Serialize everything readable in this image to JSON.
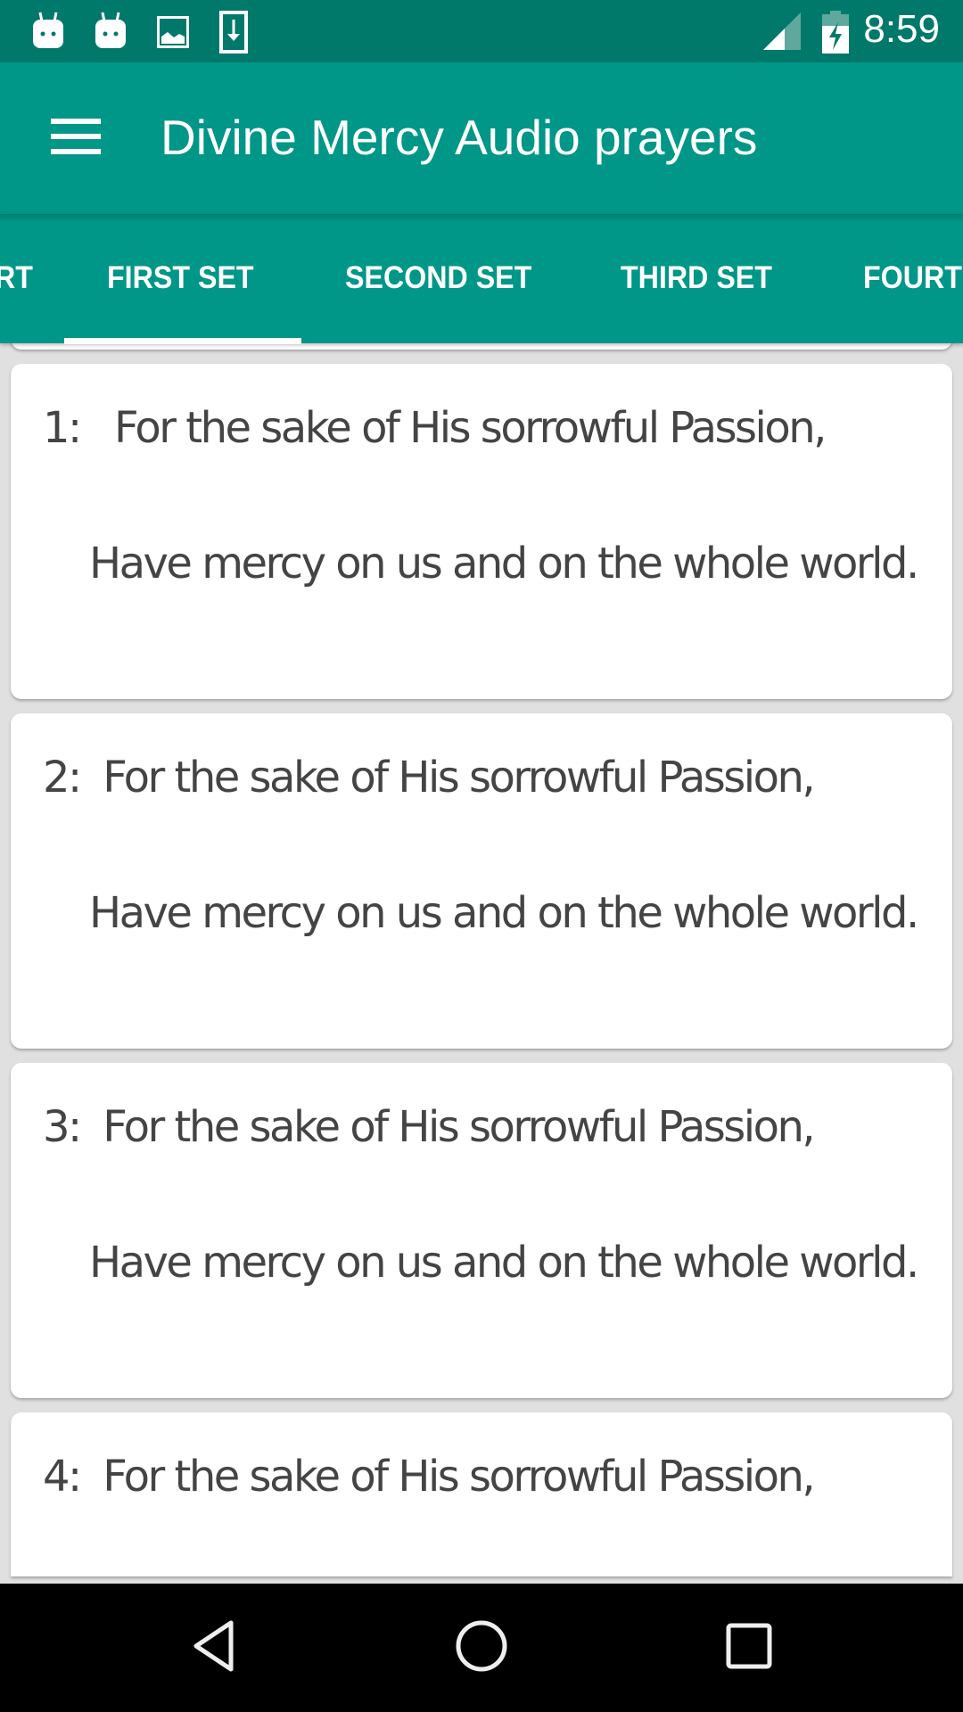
{
  "status_bar": {
    "time": "8:59",
    "left_icons": [
      "android-notification-icon",
      "android-notification-icon",
      "image-icon",
      "download-icon"
    ],
    "right_icons": [
      "cell-signal-icon",
      "battery-charging-icon"
    ]
  },
  "toolbar": {
    "menu_icon": "hamburger-menu-icon",
    "title": "Divine Mercy Audio prayers"
  },
  "tabs": {
    "items": [
      {
        "label": "RT",
        "selected": false
      },
      {
        "label": "FIRST SET",
        "selected": true
      },
      {
        "label": "SECOND SET",
        "selected": false
      },
      {
        "label": "THIRD SET",
        "selected": false
      },
      {
        "label": "FOURT",
        "selected": false
      }
    ]
  },
  "prayers": [
    {
      "number": "1:",
      "line1": "For the sake of His sorrowful Passion,",
      "line2": "Have mercy on us and on the whole world."
    },
    {
      "number": "2:",
      "line1": "For the sake of His sorrowful Passion,",
      "line2": "Have mercy on us and on the whole world."
    },
    {
      "number": "3:",
      "line1": "For the sake of His sorrowful Passion,",
      "line2": "Have mercy on us and on the whole world."
    },
    {
      "number": "4:",
      "line1": "For the sake of His sorrowful Passion,",
      "line2": ""
    }
  ],
  "nav_bar": {
    "back": "back-icon",
    "home": "home-icon",
    "recents": "recents-icon"
  },
  "colors": {
    "status_bar": "#00796b",
    "primary": "#009688",
    "background": "#e0e0e0",
    "card": "#ffffff",
    "text": "#444444"
  }
}
